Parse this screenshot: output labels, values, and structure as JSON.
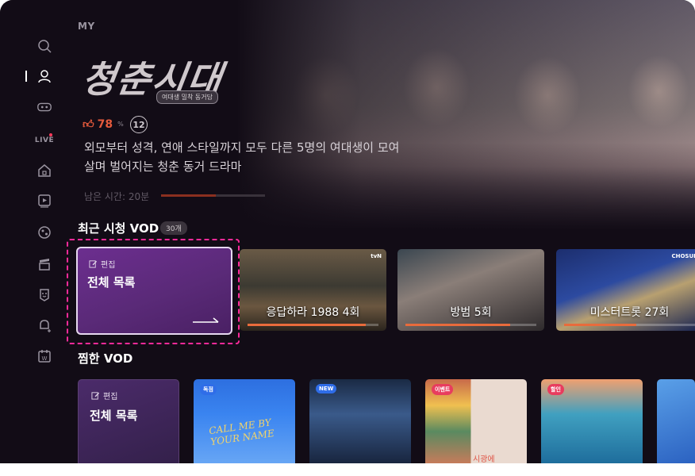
{
  "sidebar": {
    "items": [
      {
        "name": "search",
        "icon": "search-icon"
      },
      {
        "name": "my",
        "icon": "person-icon"
      },
      {
        "name": "coupon",
        "icon": "ticket-icon"
      },
      {
        "name": "live",
        "label": "LIVE"
      },
      {
        "name": "home",
        "icon": "home-icon"
      },
      {
        "name": "vod",
        "icon": "play-icon"
      },
      {
        "name": "sports",
        "icon": "ball-icon"
      },
      {
        "name": "movies",
        "icon": "clapper-icon"
      },
      {
        "name": "kids",
        "icon": "kids-icon"
      },
      {
        "name": "notifications",
        "icon": "bell-icon"
      },
      {
        "name": "calendar",
        "icon": "calendar-icon"
      }
    ]
  },
  "page": {
    "section": "MY"
  },
  "hero": {
    "title": "청춘시대",
    "subtitle": "여대생 밀착 동거담",
    "rating": "78",
    "rating_unit": "%",
    "age": "12",
    "description_line1": "외모부터 성격, 연애 스타일까지 모두 다른 5명의 여대생이 모여",
    "description_line2": "살며 벌어지는 청춘 동거 드라마",
    "remaining": "남은 시간: 20분",
    "remaining_progress": 0.53
  },
  "recent": {
    "title": "최근 시청 VOD",
    "count": "30개",
    "edit_label": "편집",
    "edit_title": "전체 목록",
    "items": [
      {
        "title": "응답하라 1988 4회",
        "progress": 0.9,
        "logo": "tvN"
      },
      {
        "title": "방범 5회",
        "progress": 0.8
      },
      {
        "title": "미스터트롯 27회",
        "progress": 0.55,
        "logo": "CHOSUN"
      }
    ]
  },
  "favorites": {
    "title": "찜한 VOD",
    "edit_label": "편집",
    "edit_title": "전체 목록",
    "posters": [
      {
        "badge": "독점",
        "badge_color": "#2f6de8",
        "text": "CALL ME BY YOUR NAME"
      },
      {
        "badge": "NEW",
        "badge_color": "#2f6de8"
      },
      {
        "badge": "이벤트",
        "badge_color": "#e83c5e",
        "text": "시광에"
      },
      {
        "badge": "할인",
        "badge_color": "#e83c5e"
      },
      {
        "badge": ""
      }
    ]
  }
}
